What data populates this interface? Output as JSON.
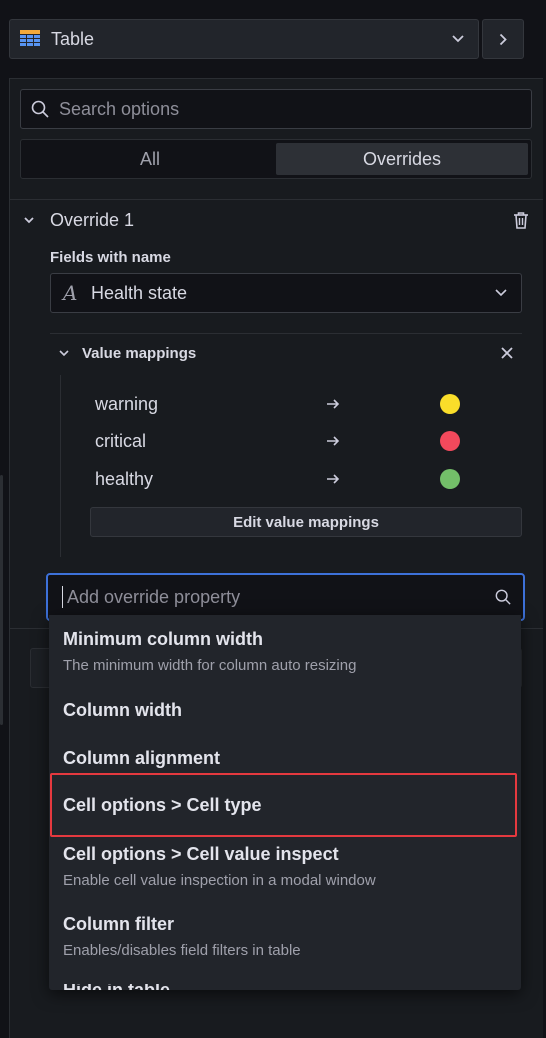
{
  "viz_picker": {
    "label": "Table",
    "icon": "table-grid-icon"
  },
  "search": {
    "placeholder": "Search options"
  },
  "tabs": [
    {
      "label": "All",
      "active": false
    },
    {
      "label": "Overrides",
      "active": true
    }
  ],
  "override": {
    "title": "Override 1",
    "fields_label": "Fields with name",
    "field_value": "Health state",
    "field_type_icon": "A"
  },
  "value_mappings": {
    "title": "Value mappings",
    "rows": [
      {
        "value": "warning",
        "color": "#fade2a"
      },
      {
        "value": "critical",
        "color": "#f2495c"
      },
      {
        "value": "healthy",
        "color": "#73bf69"
      }
    ],
    "edit_label": "Edit value mappings"
  },
  "add_override": {
    "placeholder": "Add override property"
  },
  "dropdown": {
    "options": [
      {
        "title": "Minimum column width",
        "desc": "The minimum width for column auto resizing"
      },
      {
        "title": "Column width",
        "desc": ""
      },
      {
        "title": "Column alignment",
        "desc": ""
      },
      {
        "title": "Cell options > Cell type",
        "desc": "",
        "highlighted": true
      },
      {
        "title": "Cell options > Cell value inspect",
        "desc": "Enable cell value inspection in a modal window"
      },
      {
        "title": "Column filter",
        "desc": "Enables/disables field filters in table"
      }
    ],
    "cutoff": "Hide in table"
  },
  "colors": {
    "accent": "#3d71d9",
    "highlight": "#e5393f"
  }
}
